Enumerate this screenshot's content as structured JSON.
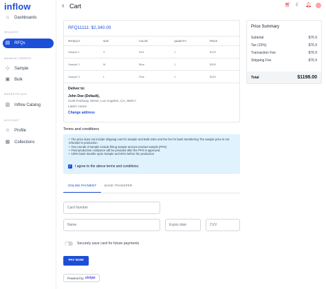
{
  "app": {
    "logo_text": "inflow"
  },
  "sidebar": {
    "items": [
      {
        "label": "Dashboards",
        "icon": "home-icon"
      },
      {
        "label": "RFQs",
        "icon": "file-icon",
        "active": true
      },
      {
        "label": "Sample",
        "icon": "tag-icon"
      },
      {
        "label": "Bulk",
        "icon": "box-icon"
      },
      {
        "label": "Inflow Catalog",
        "icon": "book-icon"
      },
      {
        "label": "Profile",
        "icon": "user-icon"
      },
      {
        "label": "Collections",
        "icon": "folder-icon"
      }
    ],
    "sections": [
      "REQUEST",
      "MANAGE ORDERS",
      "MARKETPLACE",
      "ACCOUNT"
    ]
  },
  "header": {
    "title": "Cart",
    "icons": [
      "cart-icon",
      "moon-icon",
      "bell-icon",
      "avatar"
    ]
  },
  "rfq": {
    "id": "RFQ11111:",
    "amount": "$2,340.00",
    "columns": [
      "PRODUCT",
      "SIZE",
      "COLOR",
      "QUANTITY",
      "PRICE"
    ],
    "rows": [
      [
        "Sample 1",
        "X",
        "Red",
        "1",
        "$120"
      ],
      [
        "Sample 2",
        "M",
        "Blue",
        "1",
        "$320"
      ],
      [
        "Sample 3",
        "L",
        "Pink",
        "1",
        "$320"
      ]
    ],
    "deliver_label": "Deliver to:",
    "deliver_name": "John Doe (Default),",
    "deliver_address": "4135 Parkway Street, Los Angeles, CA, 90017.",
    "deliver_type": "Label: Home",
    "change_address": "Change address"
  },
  "price_summary": {
    "title": "Price Summary",
    "rows": [
      {
        "label": "Subtotal",
        "value": "$76.9"
      },
      {
        "label": "Tax (10%)",
        "value": "$76.9"
      },
      {
        "label": "Transaction Fee",
        "value": "$76.9"
      },
      {
        "label": "Shipping Fee",
        "value": "$76.9"
      }
    ],
    "total_label": "Total",
    "total_value": "$1198.00"
  },
  "terms": {
    "title": "Terms and conditions",
    "items": [
      "The price does not include shipping cost for Sample and Bulk order and the fee for bank transferring The sample price is not refunded in production",
      "Two rounds of sample include fitting sample and pre product sample (PPS)",
      "Final production cost/piece will be provided after the PPS is approved.",
      "100% bank transfer upon Sample and 50% before the production"
    ],
    "agree_label": "I agree to the above terms and conditions."
  },
  "payment": {
    "tabs": [
      "ONLINE PAYMENT",
      "BANK TRANSFER"
    ],
    "card_number_placeholder": "Card Number",
    "name_placeholder": "Name",
    "expiry_placeholder": "Expiry date",
    "cvv_placeholder": "CVV",
    "save_label": "Securely save card for future payments",
    "pay_label": "PAY NOW",
    "powered_by": "Powered by",
    "stripe": "stripe"
  }
}
